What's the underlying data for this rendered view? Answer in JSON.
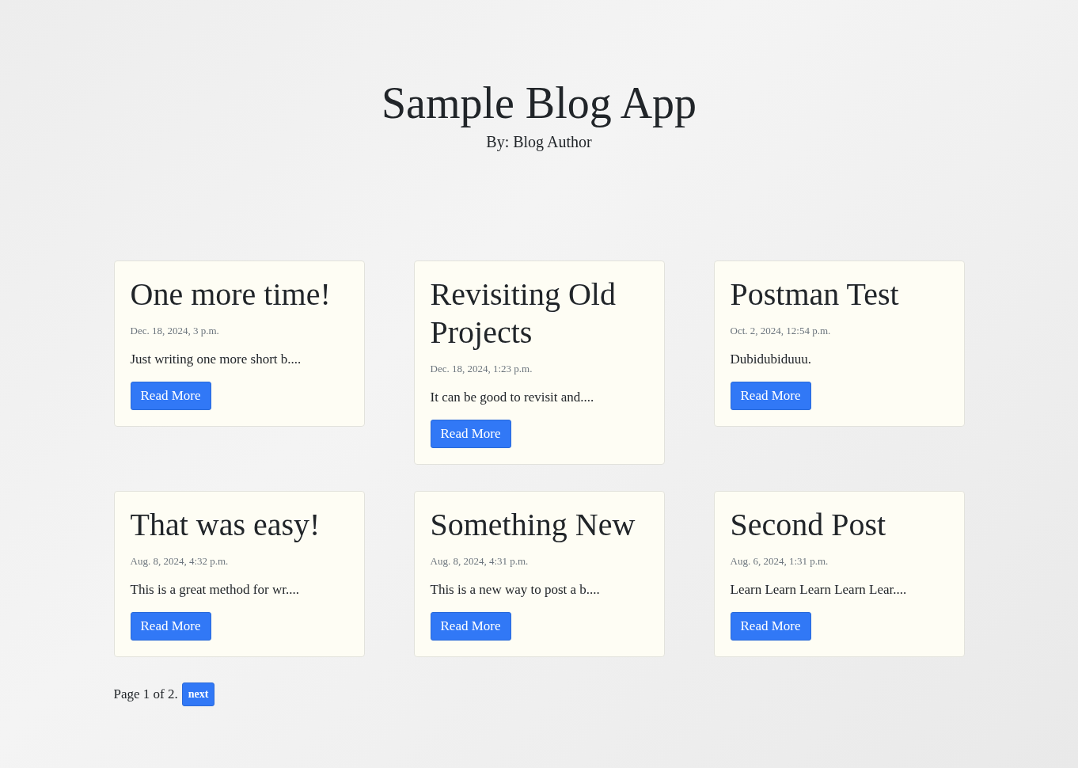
{
  "header": {
    "title": "Sample Blog App",
    "byline": "By: Blog Author"
  },
  "posts": [
    {
      "title": "One more time!",
      "date": "Dec. 18, 2024, 3 p.m.",
      "excerpt": "Just writing one more short b....",
      "button": "Read More"
    },
    {
      "title": "Revisiting Old Projects",
      "date": "Dec. 18, 2024, 1:23 p.m.",
      "excerpt": "It can be good to revisit and....",
      "button": "Read More"
    },
    {
      "title": "Postman Test",
      "date": "Oct. 2, 2024, 12:54 p.m.",
      "excerpt": "Dubidubiduuu.",
      "button": "Read More"
    },
    {
      "title": "That was easy!",
      "date": "Aug. 8, 2024, 4:32 p.m.",
      "excerpt": "This is a great method for wr....",
      "button": "Read More"
    },
    {
      "title": "Something New",
      "date": "Aug. 8, 2024, 4:31 p.m.",
      "excerpt": "This is a new way to post a b....",
      "button": "Read More"
    },
    {
      "title": "Second Post",
      "date": "Aug. 6, 2024, 1:31 p.m.",
      "excerpt": "Learn Learn Learn Learn Lear....",
      "button": "Read More"
    }
  ],
  "pagination": {
    "status": "Page 1 of 2.",
    "next": "next"
  }
}
